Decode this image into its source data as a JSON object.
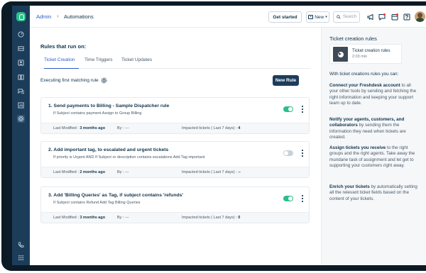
{
  "topbar": {
    "breadcrumb_admin": "Admin",
    "breadcrumb_sep": "›",
    "breadcrumb_page": "Automations",
    "get_started": "Get started",
    "new_label": "New",
    "search_placeholder": "Search"
  },
  "main": {
    "title": "Rules that run on:",
    "tabs": [
      {
        "label": "Ticket Creation",
        "active": true
      },
      {
        "label": "Time Triggers",
        "active": false
      },
      {
        "label": "Ticket Updates",
        "active": false
      }
    ],
    "exec_label": "Executing first matching rule",
    "new_rule": "New Rule",
    "rules": [
      {
        "title": "1. Send payments to Billing - Sample Dispatcher rule",
        "condition": "If Subject contains payment Assign to Group Billing",
        "enabled": true,
        "last_modified_label": "Last Modified :",
        "last_modified": "3 months ago",
        "by_label": "By :",
        "by": "---",
        "impacted_label": "Impacted tickets ( Last 7 days) :",
        "impacted": "4"
      },
      {
        "title": "2. Add important tag, to escalated and urgent tickets",
        "condition": "If priority is Urgent AND If Subject or description contains escalations Add Tag important",
        "enabled": false,
        "last_modified_label": "Last Modified :",
        "last_modified": "2 months ago",
        "by_label": "By :",
        "by": "---",
        "impacted_label": "Impacted tickets ( Last 7 days) :",
        "impacted": "--"
      },
      {
        "title": "3. Add 'Billing Queries' as Tag, if subject contains 'refunds'",
        "condition": "If Subject contains Refund Add Tag Billing Queries",
        "enabled": true,
        "last_modified_label": "Last Modified :",
        "last_modified": "3 months ago",
        "by_label": "By :",
        "by": "---",
        "impacted_label": "Impacted tickets ( Last 7 days) :",
        "impacted": "0"
      }
    ]
  },
  "panel": {
    "title": "Ticket creation rules",
    "video_title": "Ticket creation rules",
    "video_duration": "2:03 min",
    "intro": "With ticket creations rules you can:",
    "paragraphs": [
      {
        "bold": "Connect your Freshdesk account",
        "rest": " to all your other tools by sending and fetching the right information and keeping your support team up to date."
      },
      {
        "bold": "Notify your agents, customers, and collaborators",
        "rest": " by sending them the information they need when tickets are created."
      },
      {
        "bold": "Assign tickets you receive",
        "rest": " to the right groups and the right agents. Take away the mundane task of assignment and let get to supporting your customers right away."
      },
      {
        "bold": "Enrich your tickets",
        "rest": " by automatically setting all the relevant ticket fields based on the content of your tickets."
      }
    ]
  },
  "colors": {
    "sidebar": "#1c3d5a",
    "accent": "#2c5cc5",
    "toggle_on": "#2bbf8a",
    "primary_button": "#1c3d5a"
  },
  "icons": {
    "sidebar": [
      "dashboard-icon",
      "tickets-icon",
      "contacts-icon",
      "solutions-icon",
      "forums-icon",
      "reports-icon",
      "admin-icon",
      "phone-icon",
      "apps-icon"
    ],
    "topbar": [
      "search-icon",
      "megaphone-icon",
      "notifications-icon",
      "calendar-icon",
      "help-icon"
    ]
  }
}
